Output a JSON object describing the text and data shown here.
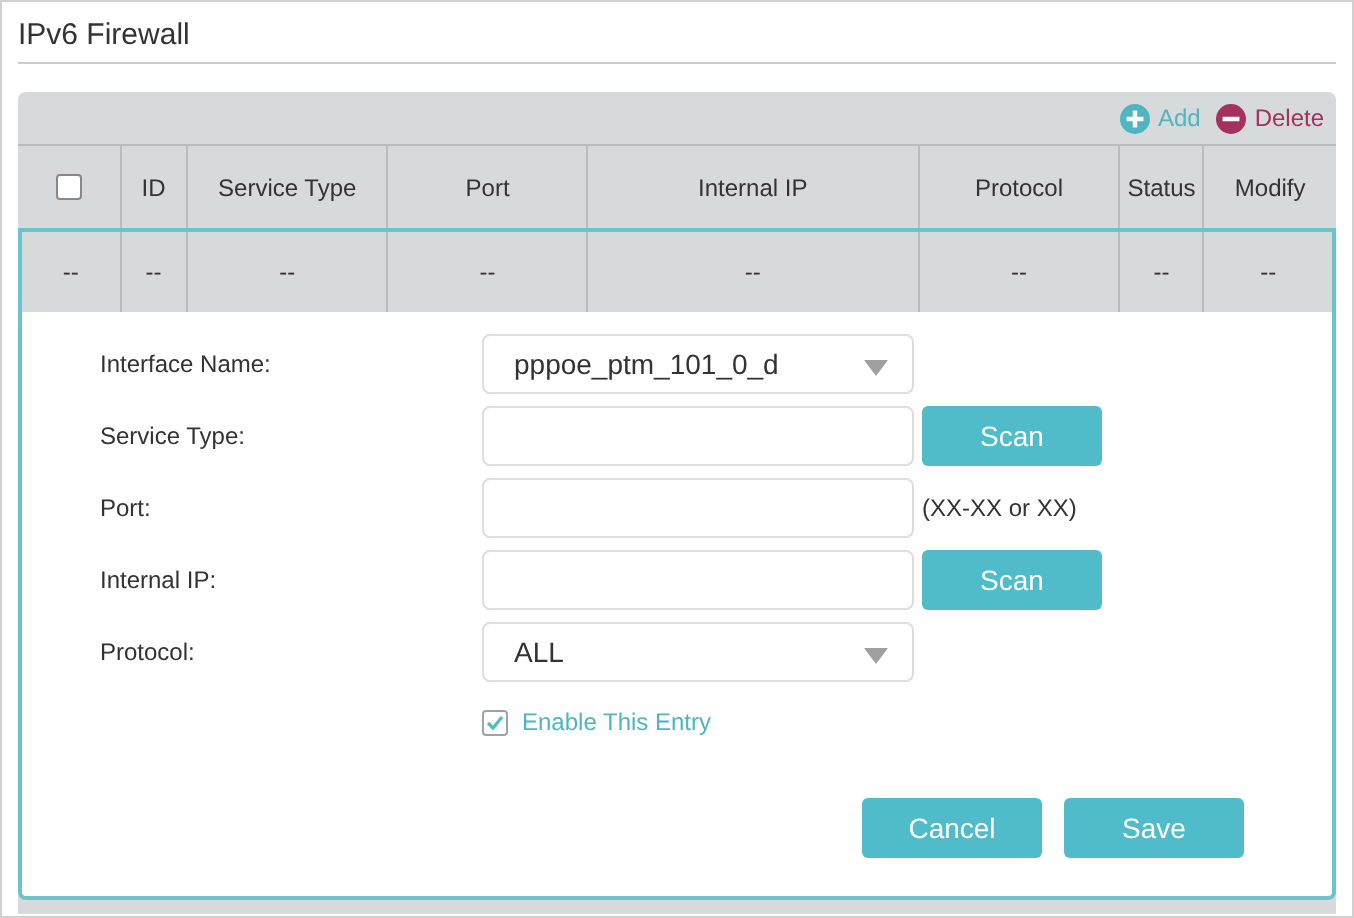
{
  "title": "IPv6 Firewall",
  "toolbar": [
    {
      "kind": "add",
      "label": "Add"
    },
    {
      "kind": "delete",
      "label": "Delete"
    }
  ],
  "table": {
    "columns": [
      {
        "kind": "checkbox",
        "checked": false
      },
      {
        "kind": "text",
        "label": "ID"
      },
      {
        "kind": "text",
        "label": "Service Type"
      },
      {
        "kind": "text",
        "label": "Port"
      },
      {
        "kind": "text",
        "label": "Internal IP"
      },
      {
        "kind": "text",
        "label": "Protocol"
      },
      {
        "kind": "text",
        "label": "Status"
      },
      {
        "kind": "text",
        "label": "Modify"
      }
    ],
    "rows": [
      {
        "selected": true,
        "cells": [
          "--",
          "--",
          "--",
          "--",
          "--",
          "--",
          "--",
          "--"
        ]
      }
    ]
  },
  "form": {
    "fields": [
      {
        "kind": "select",
        "label": "Interface Name:",
        "value": "pppoe_ptm_101_0_d"
      },
      {
        "kind": "input",
        "label": "Service Type:",
        "button": "Scan"
      },
      {
        "kind": "input",
        "label": "Port:",
        "hint": "(XX-XX or XX)"
      },
      {
        "kind": "input",
        "label": "Internal IP:",
        "button": "Scan"
      },
      {
        "kind": "select",
        "label": "Protocol:",
        "value": "ALL"
      }
    ],
    "enable": {
      "label": "Enable This Entry",
      "checked": true
    },
    "buttons": [
      "Cancel",
      "Save"
    ]
  }
}
